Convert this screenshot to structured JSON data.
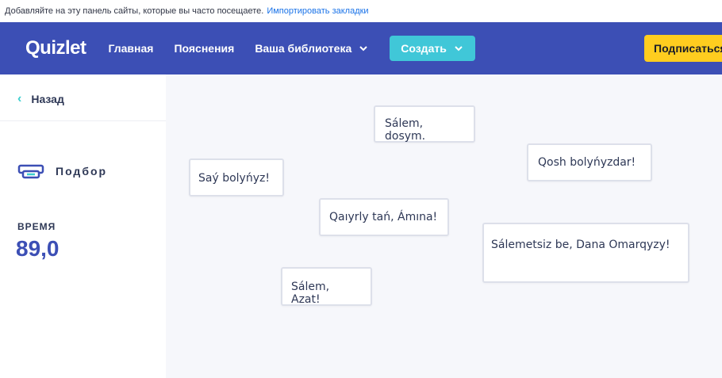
{
  "bookmarks_bar": {
    "text": "Добавляйте на эту панель сайты, которые вы часто посещаете.",
    "link": "Импортировать закладки"
  },
  "header": {
    "logo": "Quizlet",
    "nav": {
      "home": "Главная",
      "explanations": "Пояснения",
      "library": "Ваша библиотека"
    },
    "create": "Создать",
    "subscribe": "Подписаться"
  },
  "sidebar": {
    "back": "Назад",
    "mode": "Подбор",
    "time_label": "ВРЕМЯ",
    "time_value": "89,0"
  },
  "cards": [
    "Sálem, dosym.",
    "Qosh bolyńyzdar!",
    "Saý bolyńyz!",
    "Qaıyrly tań, Ámına!",
    "Sálemetsiz be, Dana Omarqyzy!",
    "Sálem, Azat!"
  ],
  "colors": {
    "header_bg": "#3c4fb5",
    "create_btn": "#40c7d8",
    "subscribe_btn": "#ffcd1f",
    "time_value": "#3c4fb5",
    "board_bg": "#f6f7fb"
  }
}
